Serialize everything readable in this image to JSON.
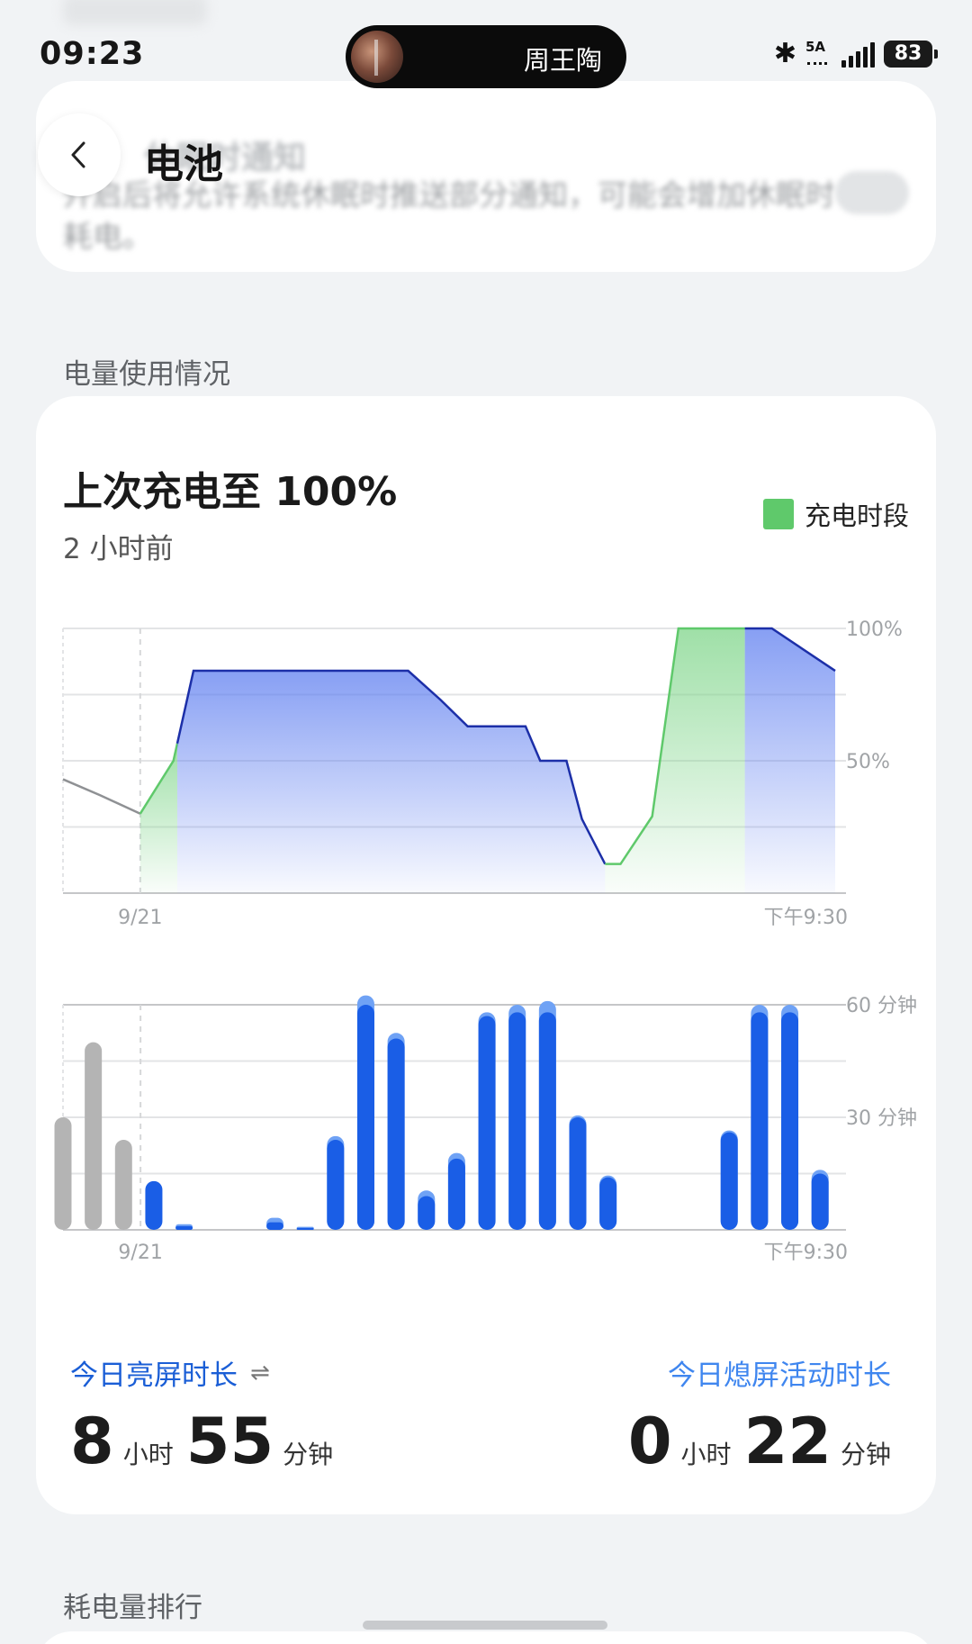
{
  "status_bar": {
    "time": "09:23",
    "now_playing": "周王陶",
    "network_label": "5A",
    "battery_level": "83"
  },
  "background_card": {
    "title": "休眠时通知",
    "description": "开启后将允许系统休眠时推送部分通知，可能会增加休眠时耗电。"
  },
  "header": {
    "back_icon": "chevron-left-icon",
    "title": "电池"
  },
  "usage_section_title": "电量使用情况",
  "battery_card": {
    "last_charge": "上次充电至 100%",
    "last_charge_time": "2 小时前",
    "legend_label": "充电时段",
    "legend_color": "#5fc96b"
  },
  "chart_data": [
    {
      "type": "area",
      "title": "",
      "x_labels": [
        "9/21",
        "下午9:30"
      ],
      "y_tick_labels": [
        "100%",
        "50%"
      ],
      "ylim": [
        0,
        100
      ],
      "unit": "%",
      "x": [
        0,
        4.8,
        10,
        14.3,
        16.9,
        24.3,
        28.3,
        30,
        32.2,
        33.5,
        36.7,
        37.2,
        44.7,
        48.9,
        52.4,
        54.6,
        59.9,
        61.8,
        65.2,
        67.2,
        70.2,
        72.2,
        76.3,
        79.7,
        84.9,
        91.8,
        100
      ],
      "y": [
        43,
        37,
        30,
        50,
        84,
        84,
        84,
        84,
        84,
        84,
        84,
        84,
        84,
        73,
        63,
        63,
        63,
        50,
        50,
        28,
        11,
        11,
        29,
        100,
        100,
        100,
        84
      ],
      "series": [
        {
          "name": "充电时段",
          "color": "#5fc96b"
        },
        {
          "name": "",
          "color": "#2f5fe0"
        }
      ],
      "charging_segments": [
        [
          10,
          14.8
        ],
        [
          70.2,
          88.3
        ]
      ],
      "previous_day_end_x": 10,
      "grid": true
    },
    {
      "type": "bar",
      "title": "",
      "x_labels": [
        "9/21",
        "下午9:30"
      ],
      "y_tick_labels": [
        "60 分钟",
        "30 分钟"
      ],
      "ylim": [
        0,
        60
      ],
      "unit": "分钟",
      "categories": [
        "1",
        "2",
        "3",
        "4",
        "5",
        "6",
        "7",
        "8",
        "9",
        "10",
        "11",
        "12",
        "13",
        "14",
        "15",
        "16",
        "17",
        "18",
        "19",
        "20",
        "21",
        "22",
        "23",
        "24",
        "25",
        "26"
      ],
      "series": [
        {
          "name": "",
          "color": "#1a5ee6",
          "values": [
            30,
            50,
            24,
            13,
            1,
            0,
            0,
            2,
            0.5,
            24,
            60,
            51,
            9,
            19,
            57,
            58,
            58,
            30,
            14,
            0,
            0,
            0,
            26,
            58,
            58,
            15
          ]
        },
        {
          "name": "",
          "color": "#6fa2f5",
          "values": [
            0,
            0,
            0,
            0,
            0.5,
            0,
            0,
            1.2,
            0.3,
            1,
            2.5,
            1.5,
            1.5,
            1.5,
            1,
            2,
            3,
            0.5,
            0.5,
            0,
            0,
            0,
            0.5,
            2,
            2,
            1
          ]
        }
      ],
      "previous_day_bars": 3,
      "previous_day_color": "#b4b4b4",
      "grid": true
    }
  ],
  "stats": {
    "screen_on_label": "今日亮屏时长",
    "screen_on_hours": "8",
    "screen_on_minutes": "55",
    "screen_off_label": "今日熄屏活动时长",
    "screen_off_hours": "0",
    "screen_off_minutes": "22",
    "unit_hour": "小时",
    "unit_minute": "分钟",
    "swap_icon": "swap-icon"
  },
  "ranking_section_title": "耗电量排行"
}
